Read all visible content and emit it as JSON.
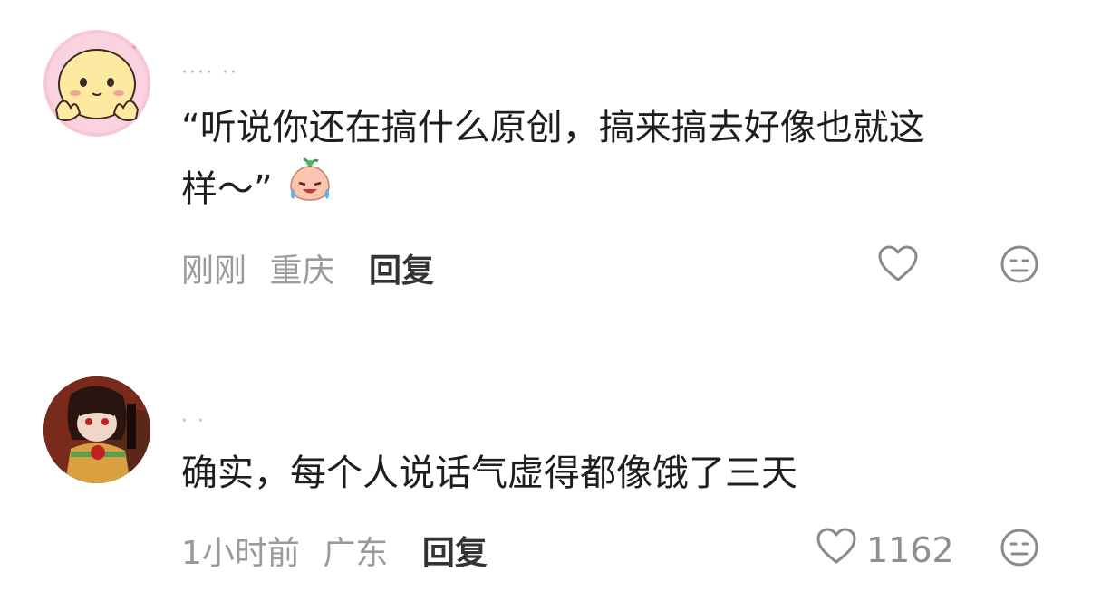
{
  "comments": [
    {
      "username": "···· ··",
      "text_line1": "“听说你还在搞什么原创，搞来搞去好像也就这",
      "text_line2": "样～”",
      "emoji": "crying-laugh-peach-emoji",
      "time": "刚刚",
      "location": "重庆",
      "reply_label": "回复",
      "likes": ""
    },
    {
      "username": "· ·",
      "text_line1": "确实，每个人说话气虚得都像饿了三天",
      "time": "1小时前",
      "location": "广东",
      "reply_label": "回复",
      "likes": "1162"
    }
  ],
  "icons": {
    "like": "heart-outline-icon",
    "dislike": "meh-face-icon"
  },
  "colors": {
    "meta_gray": "#9a9a9a",
    "icon_gray": "#8a8a8a",
    "text_dark": "#1e1e1e"
  }
}
